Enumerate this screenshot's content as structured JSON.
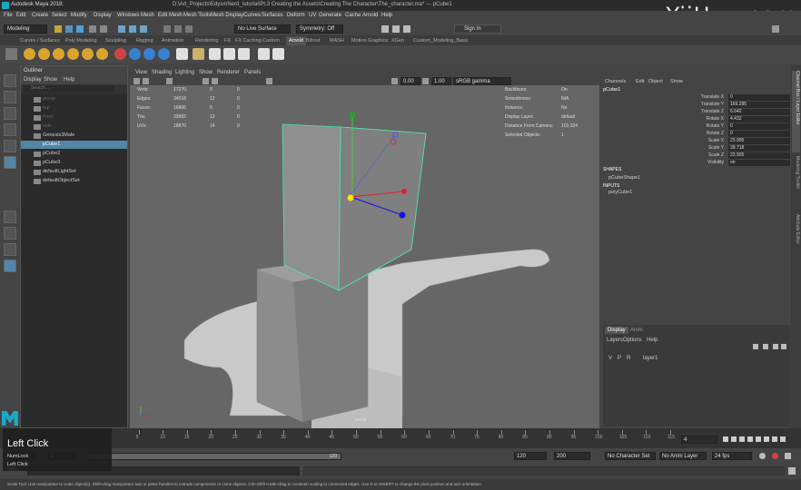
{
  "title_bar": {
    "app": "Autodesk Maya 2018:",
    "document": "D:\\Art_Projects\\EdysmNerd_tutorial\\Pt.3 Creating the Assets\\Creating The Character\\The_character.ma* --- pCube1"
  },
  "watermark": "YiiHuu.com",
  "menu": [
    "File",
    "Edit",
    "Create",
    "Select",
    "Modify",
    "Display",
    "Windows",
    "Mesh",
    "Edit Mesh",
    "Mesh Tools",
    "Mesh Display",
    "Curves",
    "Surfaces",
    "Deform",
    "UV",
    "Generate",
    "Cache",
    "Arnold",
    "Help"
  ],
  "status_line": {
    "mode": "Modeling",
    "live_surface": "No Live Surface",
    "symmetry": "Symmetry: Off",
    "sign_in": "Sign In"
  },
  "shelf_tabs": [
    "Curves / Surfaces",
    "Poly Modeling",
    "Sculpting",
    "Rigging",
    "Animation",
    "Rendering",
    "FX",
    "FX Caching",
    "Custom",
    "Arnold",
    "Bifrost",
    "MASH",
    "Motion Graphics",
    "XGen",
    "Custom_Modeling_Basic"
  ],
  "active_shelf_tab": "Arnold",
  "outliner": {
    "title": "Outliner",
    "menu": [
      "Display",
      "Show",
      "Help"
    ],
    "search_placeholder": "Search...",
    "items": [
      "persp",
      "top",
      "front",
      "side",
      "Genesis3Male",
      "pCube1",
      "pCube2",
      "pCube3",
      "defaultLightSet",
      "defaultObjectSet"
    ],
    "selected": "pCube1"
  },
  "viewport": {
    "menu": [
      "View",
      "Shading",
      "Lighting",
      "Show",
      "Renderer",
      "Panels"
    ],
    "exposure": "0.00",
    "gamma": "1.00",
    "colorspace": "sRGB gamma",
    "hud_left": [
      {
        "label": "Verts:",
        "v1": "17270",
        "v2": "8",
        "v3": "0"
      },
      {
        "label": "Edges:",
        "v1": "34018",
        "v2": "12",
        "v3": "0"
      },
      {
        "label": "Faces:",
        "v1": "16866",
        "v2": "6",
        "v3": "0"
      },
      {
        "label": "Tris:",
        "v1": "33682",
        "v2": "12",
        "v3": "0"
      },
      {
        "label": "UVs:",
        "v1": "18870",
        "v2": "14",
        "v3": "0"
      }
    ],
    "hud_right": [
      {
        "label": "Backfaces:",
        "value": "On"
      },
      {
        "label": "Smoothness:",
        "value": "N/A"
      },
      {
        "label": "Instance:",
        "value": "No"
      },
      {
        "label": "Display Layer:",
        "value": "default"
      },
      {
        "label": "Distance From Camera:",
        "value": "103.324"
      },
      {
        "label": "Selected Objects:",
        "value": "1"
      }
    ],
    "camera": "persp"
  },
  "channel_box": {
    "menu": [
      "Channels",
      "Edit",
      "Object",
      "Show"
    ],
    "object": "pCube1",
    "attributes": [
      {
        "label": "Translate X",
        "value": "0"
      },
      {
        "label": "Translate Y",
        "value": "169.295"
      },
      {
        "label": "Translate Z",
        "value": "6.642"
      },
      {
        "label": "Rotate X",
        "value": "4.432"
      },
      {
        "label": "Rotate Y",
        "value": "0"
      },
      {
        "label": "Rotate Z",
        "value": "0"
      },
      {
        "label": "Scale X",
        "value": "23.905"
      },
      {
        "label": "Scale Y",
        "value": "39.718"
      },
      {
        "label": "Scale Z",
        "value": "23.905"
      },
      {
        "label": "Visibility",
        "value": "on"
      }
    ],
    "shapes_header": "SHAPES",
    "shape": "pCubeShape1",
    "inputs_header": "INPUTS",
    "input": "polyCube1",
    "side_tabs": [
      "Channel Box / Layer Editor",
      "Modeling Toolkit",
      "Attribute Editor"
    ]
  },
  "layer_editor": {
    "tabs": [
      "Display",
      "Anim"
    ],
    "menu": [
      "Layers",
      "Options",
      "Help"
    ],
    "layer": {
      "v": "V",
      "p": "P",
      "r": "R",
      "name": "layer1"
    }
  },
  "timeline": {
    "ticks": [
      "5",
      "10",
      "15",
      "20",
      "25",
      "30",
      "35",
      "40",
      "45",
      "50",
      "55",
      "60",
      "65",
      "70",
      "75",
      "80",
      "85",
      "90",
      "95",
      "100",
      "105",
      "110",
      "115"
    ],
    "current_frame": "4"
  },
  "range": {
    "start": "1",
    "end": "120",
    "anim_end": "120",
    "anim_end2": "200",
    "character_set": "No Character Set",
    "anim_layer": "No Anim Layer",
    "fps": "24 fps"
  },
  "command_line": {
    "lang": "MEL"
  },
  "help_line": "Scale Tool: Use manipulator to scale object(s). Shift+drag manipulator axis or plane handles to extrude components or clone objects. Ctrl+Shift+LMB+drag to constrain scaling to connected edges. Use D or INSERT to change the pivot position and axis orientation.",
  "key_overlay": {
    "title": "Left Click",
    "line1": "NumLock",
    "line2": "Left Click"
  },
  "colors": {
    "selection": "#5285a6",
    "x_axis": "#e0222d",
    "y_axis": "#ffe300",
    "z_axis": "#1313e6",
    "selected_wire": "#48e8a8"
  }
}
